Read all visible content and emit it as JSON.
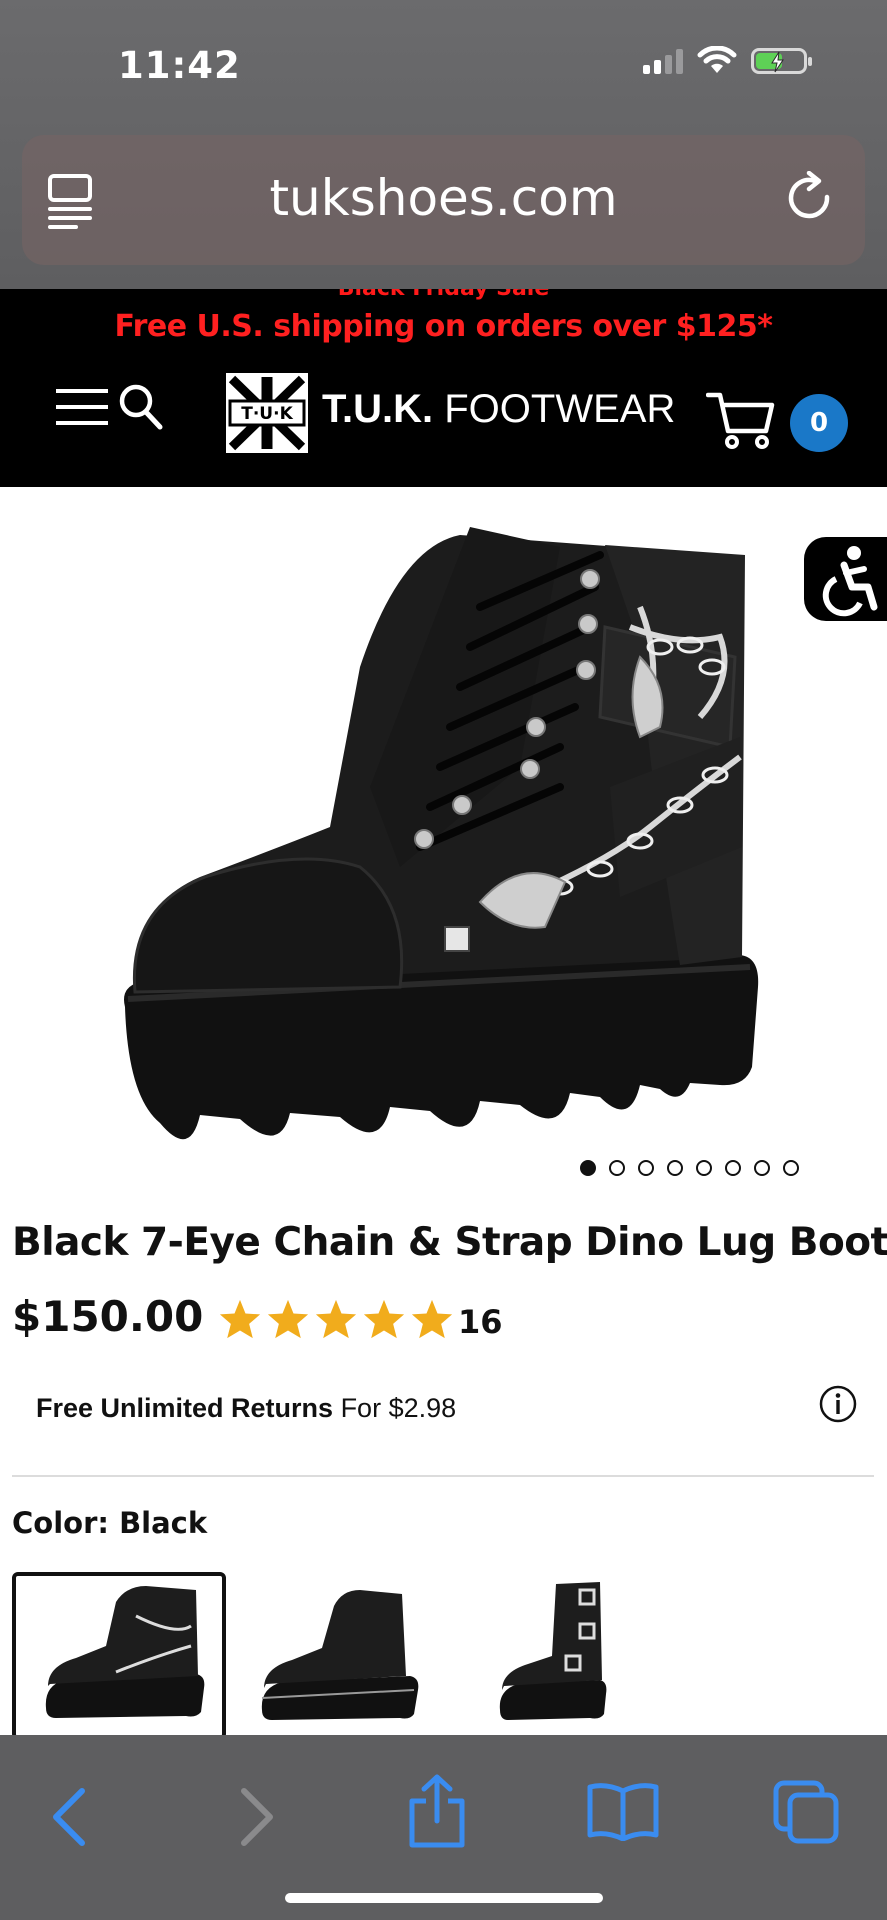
{
  "status_bar": {
    "time": "11:42"
  },
  "browser": {
    "url": "tukshoes.com"
  },
  "site_header": {
    "promo_clipped": "Black Friday Sale",
    "promo": "Free U.S. shipping on orders over $125*",
    "logo_badge": "T·U·K",
    "logo_bold": "T.U.K.",
    "logo_light": " FOOTWEAR",
    "cart_count": "0"
  },
  "carousel": {
    "total": 8,
    "active_index": 0
  },
  "product": {
    "title": "Black 7-Eye Chain & Strap Dino Lug Boot",
    "price": "$150.00",
    "rating": 5,
    "review_count": "16",
    "returns_bold": "Free Unlimited Returns",
    "returns_rest": " For $2.98",
    "color_label": "Color: Black"
  },
  "colors": {
    "header_bg": "#000000",
    "promo_red": "#ff2020",
    "cart_badge": "#1a78c8",
    "star": "#f1ac1c",
    "safari_blue": "#3a8cf0"
  }
}
